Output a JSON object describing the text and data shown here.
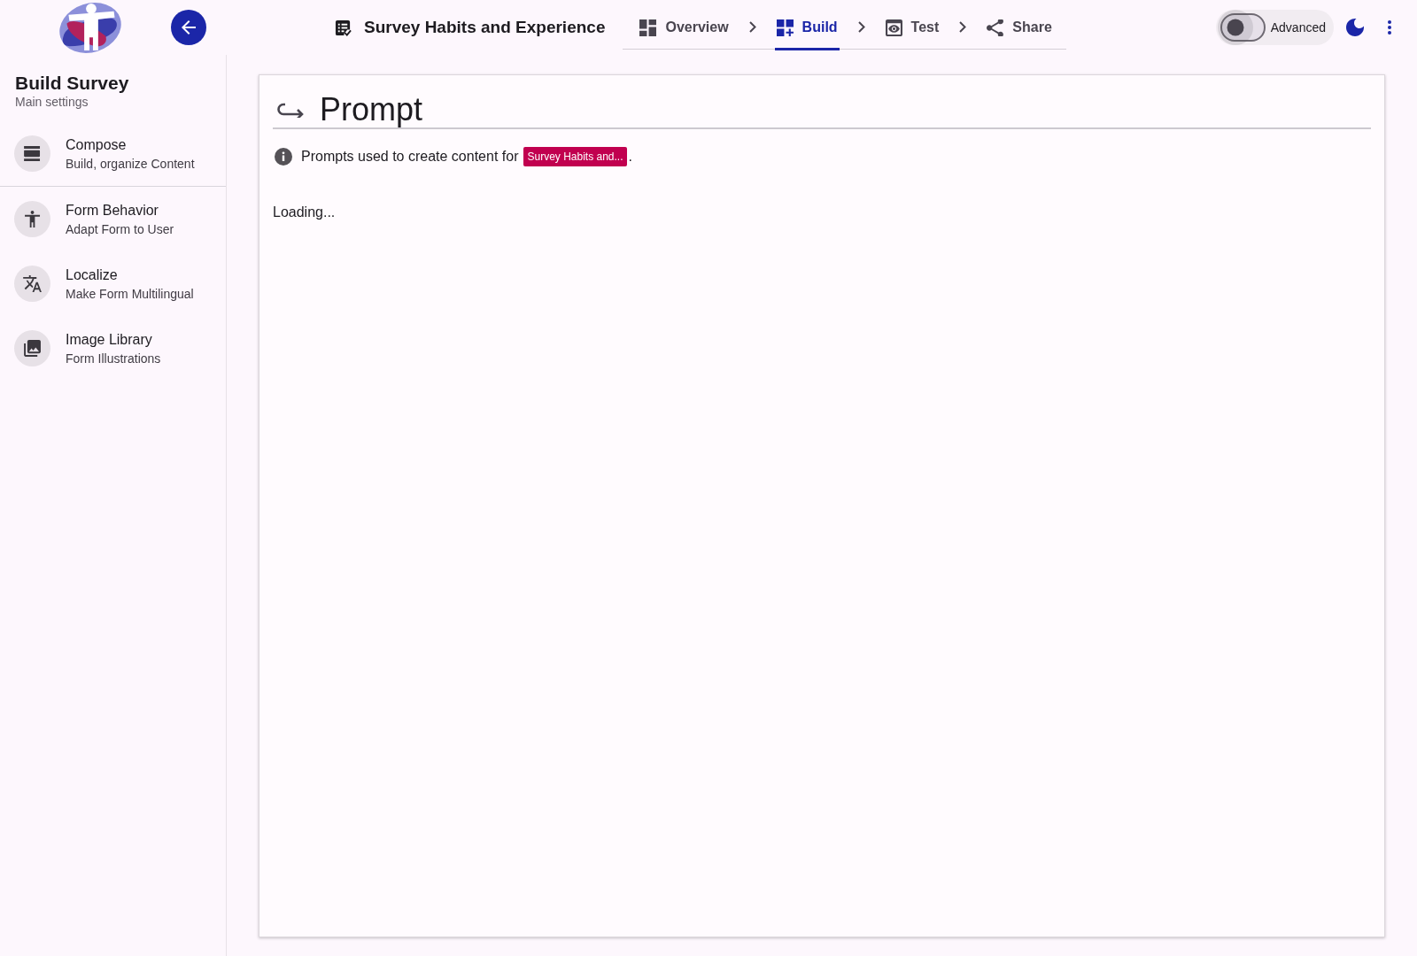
{
  "header": {
    "title": "Survey Habits and Experience",
    "steps": [
      {
        "label": "Overview",
        "selected": false
      },
      {
        "label": "Build",
        "selected": true
      },
      {
        "label": "Test",
        "selected": false
      },
      {
        "label": "Share",
        "selected": false
      }
    ],
    "advanced_toggle": {
      "label": "Advanced",
      "on": false
    }
  },
  "sidebar": {
    "title": "Build Survey",
    "subtitle": "Main settings",
    "sections": [
      {
        "items": [
          {
            "title": "Compose",
            "subtitle": "Build, organize Content"
          }
        ]
      },
      {
        "items": [
          {
            "title": "Form Behavior",
            "subtitle": "Adapt Form to User"
          },
          {
            "title": "Localize",
            "subtitle": "Make Form Multilingual"
          },
          {
            "title": "Image Library",
            "subtitle": "Form Illustrations"
          }
        ]
      }
    ]
  },
  "panel": {
    "title": "Prompt",
    "info": {
      "text": "Prompts used to create content for",
      "tag": "Survey Habits and...",
      "end": "."
    },
    "status": "Loading..."
  }
}
